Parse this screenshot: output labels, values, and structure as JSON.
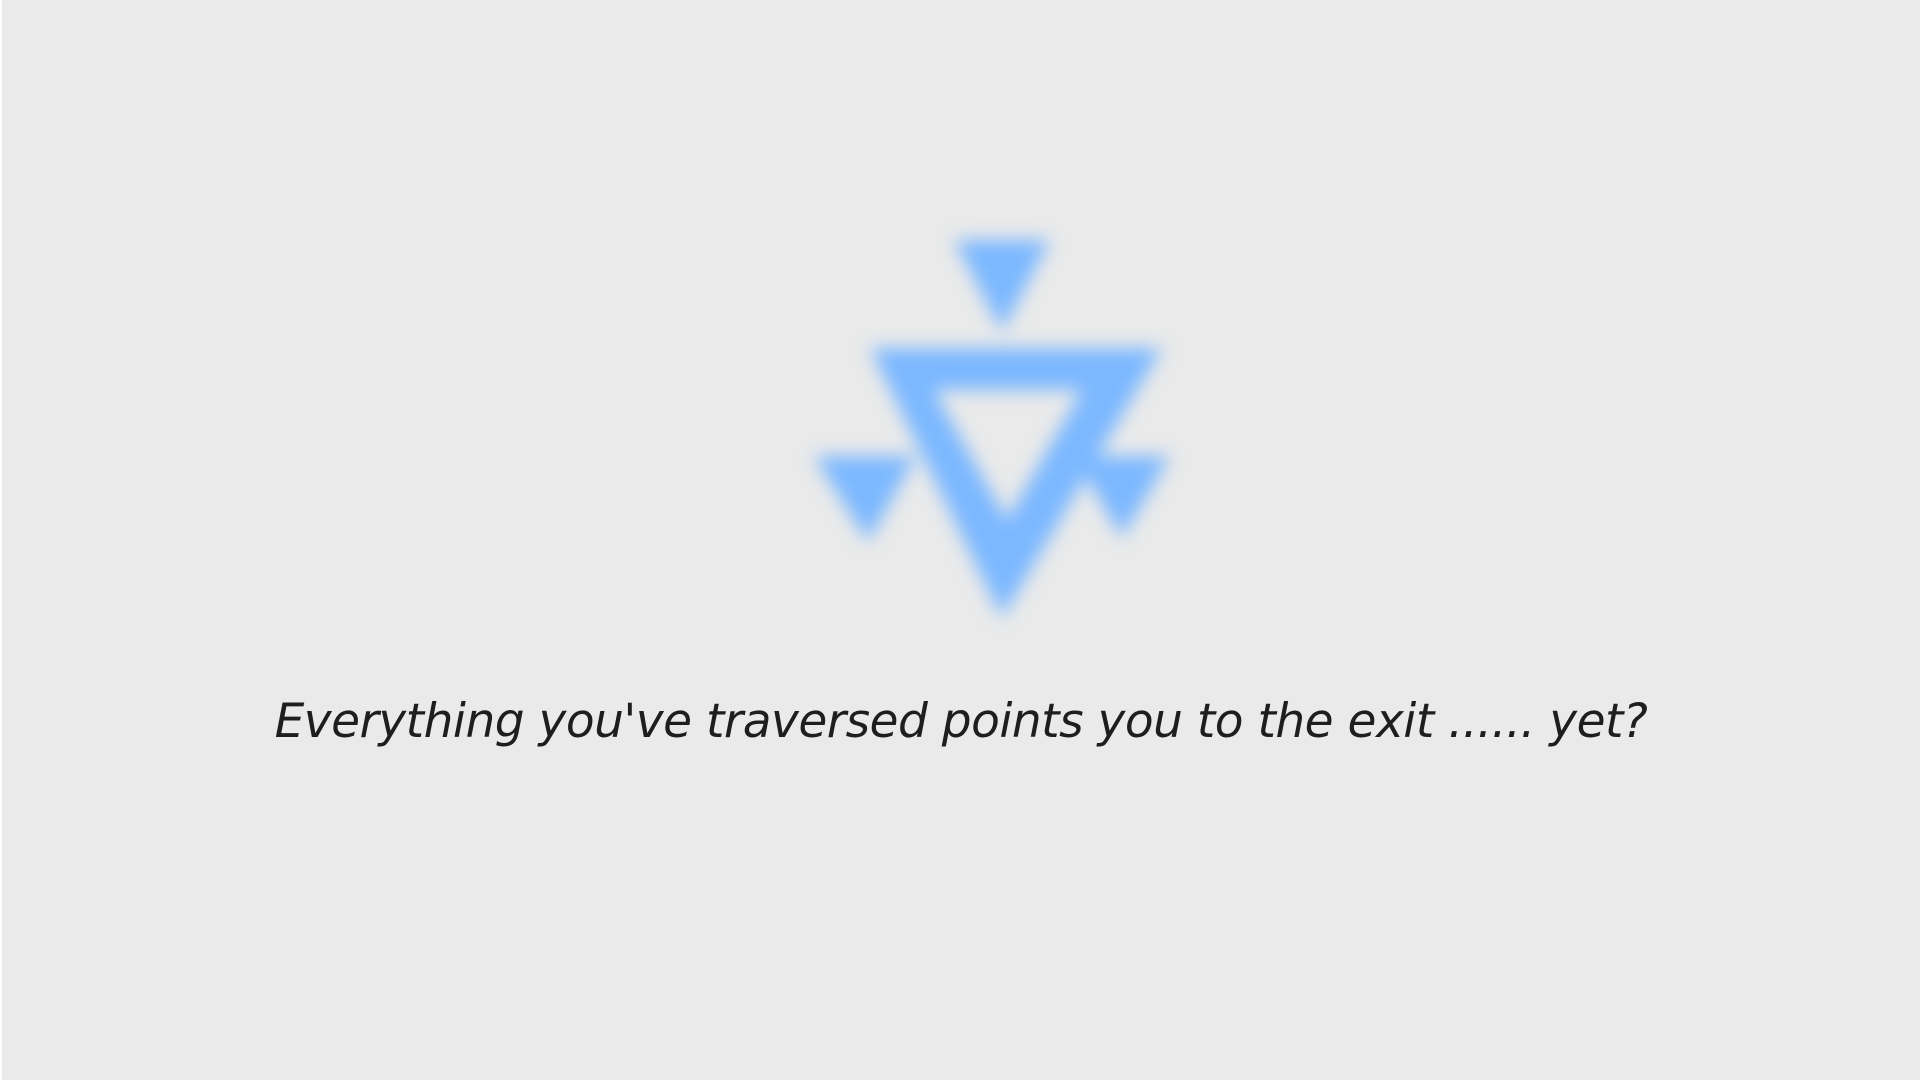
{
  "scene": {
    "background_color": "#eaeaea",
    "logo_color": "#7cb8ff",
    "logo_icon": "blurred-triangle-emblem",
    "message": "Everything you've traversed points you to the exit ...... yet?"
  }
}
